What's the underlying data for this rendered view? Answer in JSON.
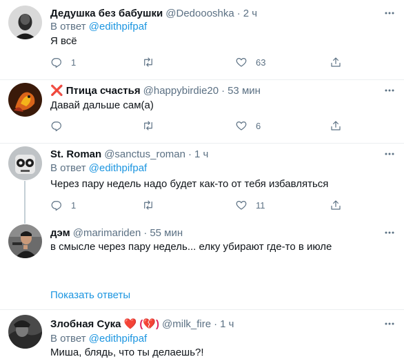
{
  "tweets": [
    {
      "name": "Дедушка без бабушки",
      "handle": "@Dedoooshka",
      "dot": "·",
      "time": "2 ч",
      "reply_prefix": "В ответ",
      "reply_handle": "@edithpifpaf",
      "text": "Я всё",
      "replies": "1",
      "retweets": "",
      "likes": "63"
    },
    {
      "name": "Птица счастья",
      "name_emoji": "❌",
      "handle": "@happybirdie20",
      "dot": "·",
      "time": "53 мин",
      "text": "Давай дальше сам(а)",
      "replies": "",
      "retweets": "",
      "likes": "6"
    },
    {
      "name": "St. Roman",
      "handle": "@sanctus_roman",
      "dot": "·",
      "time": "1 ч",
      "reply_prefix": "В ответ",
      "reply_handle": "@edithpifpaf",
      "text": "Через пару недель надо будет как-то от тебя избавляться",
      "replies": "1",
      "retweets": "",
      "likes": "11"
    },
    {
      "name": "дэм",
      "handle": "@marimariden",
      "dot": "·",
      "time": "55 мин",
      "text": "в смысле через пару недель... елку убирают где-то в июле"
    },
    {
      "name": "Злобная Сука",
      "name_suffix": "❤️ (💔)",
      "handle": "@milk_fire",
      "dot": "·",
      "time": "1 ч",
      "reply_prefix": "В ответ",
      "reply_handle": "@edithpifpaf",
      "text": "Миша, блядь, что ты делаешь?!"
    }
  ],
  "show_replies": "Показать ответы",
  "icons": {
    "reply": "reply-icon",
    "retweet": "retweet-icon",
    "like": "like-icon",
    "share": "share-icon",
    "more": "more-icon"
  },
  "colors": {
    "link": "#1b95e0",
    "secondary": "#5b7083",
    "separator": "#ebeef0",
    "heart": "#e0245e",
    "cross": "#dd2e44"
  }
}
